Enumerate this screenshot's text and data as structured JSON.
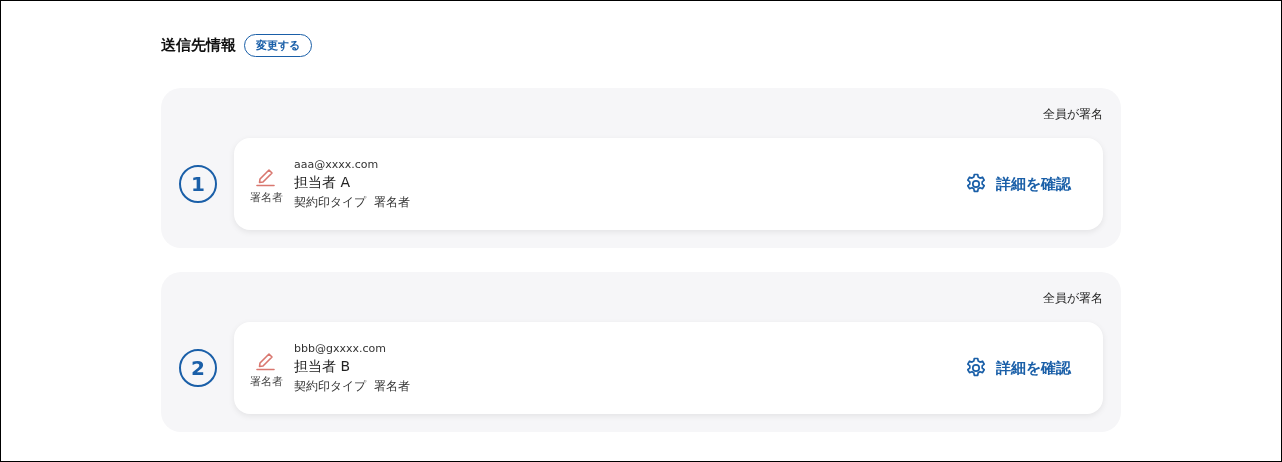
{
  "section": {
    "title": "送信先情報",
    "change_button": "変更する"
  },
  "recipients": [
    {
      "number": "1",
      "signing_rule": "全員が署名",
      "role_label": "署名者",
      "email": "aaa@xxxx.com",
      "name": "担当者 A",
      "type_label": "契約印タイプ",
      "type_value": "署名者",
      "details_button": "詳細を確認"
    },
    {
      "number": "2",
      "signing_rule": "全員が署名",
      "role_label": "署名者",
      "email": "bbb@gxxxx.com",
      "name": "担当者 B",
      "type_label": "契約印タイプ",
      "type_value": "署名者",
      "details_button": "詳細を確認"
    }
  ]
}
